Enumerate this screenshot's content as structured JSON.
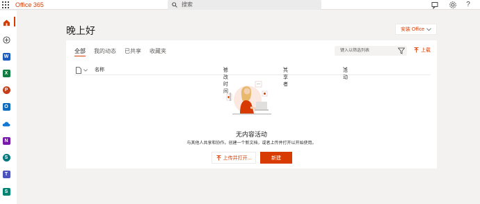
{
  "header": {
    "brand": "Office 365",
    "search_placeholder": "搜索"
  },
  "greeting": "晚上好",
  "install_button": "安装 Office",
  "tabs": [
    {
      "label": "全部",
      "active": true
    },
    {
      "label": "我的动态",
      "active": false
    },
    {
      "label": "已共享",
      "active": false
    },
    {
      "label": "收藏夹",
      "active": false
    }
  ],
  "filter_placeholder": "键入以筛选列表",
  "upload_label": "上载",
  "columns": {
    "name": "名称",
    "modified": "修改时间",
    "shared_by": "共享者",
    "activity": "活动"
  },
  "empty_state": {
    "title": "无内容活动",
    "description": "与其他人共享和协作。创建一个新文档，或者上传并打开以开始使用。",
    "upload_open_button": "上传并打开...",
    "new_button": "新建"
  },
  "rail_apps": [
    {
      "name": "home",
      "letter": "",
      "color": "#d83b01"
    },
    {
      "name": "create",
      "letter": "",
      "color": "#444444"
    },
    {
      "name": "word",
      "letter": "W",
      "color": "#185abd"
    },
    {
      "name": "excel",
      "letter": "X",
      "color": "#107c41"
    },
    {
      "name": "powerpoint",
      "letter": "P",
      "color": "#c43e1c"
    },
    {
      "name": "outlook",
      "letter": "O",
      "color": "#0f6cbd"
    },
    {
      "name": "onedrive",
      "letter": "",
      "color": "#0f78d4"
    },
    {
      "name": "onenote",
      "letter": "N",
      "color": "#7719aa"
    },
    {
      "name": "sharepoint",
      "letter": "S",
      "color": "#03787c"
    },
    {
      "name": "teams",
      "letter": "T",
      "color": "#4b53bc"
    },
    {
      "name": "sway",
      "letter": "S",
      "color": "#008272"
    }
  ],
  "colors": {
    "accent": "#d83b01",
    "background": "#f3f2f1"
  }
}
